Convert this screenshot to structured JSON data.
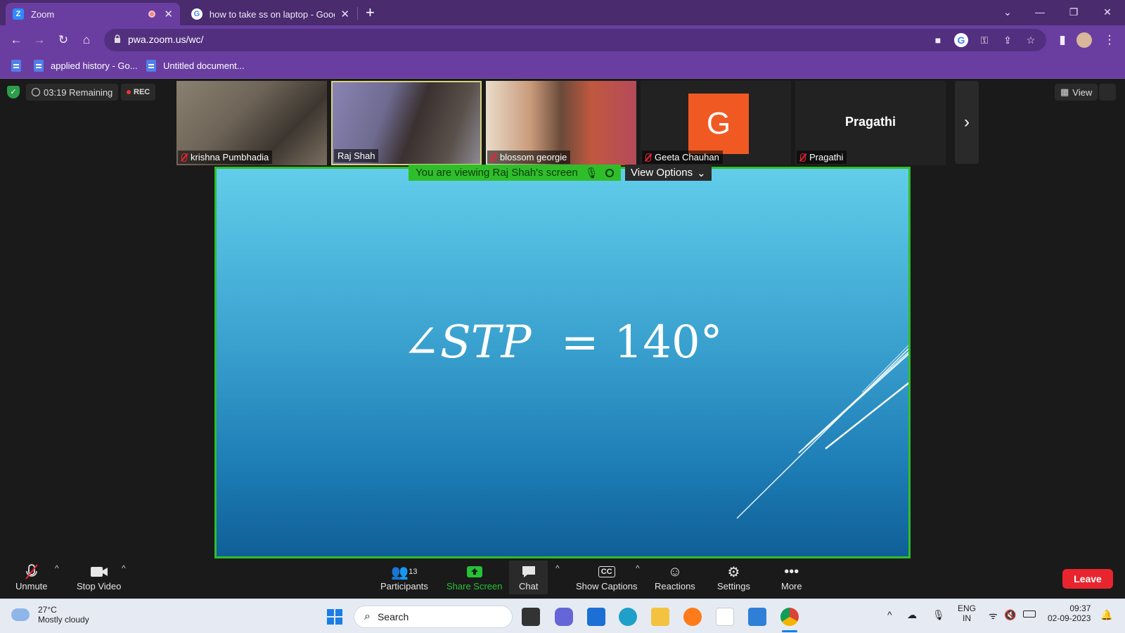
{
  "browser": {
    "tabs": [
      {
        "title": "Zoom",
        "active": true,
        "favicon_letter": "Z"
      },
      {
        "title": "how to take ss on laptop - Googl",
        "active": false
      }
    ],
    "url": "pwa.zoom.us/wc/",
    "bookmarks": [
      "applied history - Go...",
      "Untitled document..."
    ]
  },
  "meeting": {
    "timer": "03:19 Remaining",
    "rec": "REC",
    "view_label": "View",
    "participants": [
      {
        "name": "krishna Pumbhadia",
        "muted": true
      },
      {
        "name": "Raj Shah",
        "muted": false,
        "active_speaker": true
      },
      {
        "name": "blossom georgie",
        "muted": true
      },
      {
        "name": "Geeta Chauhan",
        "muted": true,
        "avatar_letter": "G"
      },
      {
        "name": "Pragathi",
        "muted": true,
        "display_name": "Pragathi"
      }
    ],
    "viewing_banner": "You are viewing Raj Shah's screen",
    "view_options": "View Options",
    "shared_formula": {
      "angle_symbol": "∠",
      "label": "STP",
      "equals": "=",
      "value": "140°"
    }
  },
  "toolbar": {
    "unmute": "Unmute",
    "stop_video": "Stop Video",
    "participants": "Participants",
    "participants_count": "13",
    "share_screen": "Share Screen",
    "chat": "Chat",
    "show_captions": "Show Captions",
    "reactions": "Reactions",
    "settings": "Settings",
    "more": "More",
    "leave": "Leave"
  },
  "taskbar": {
    "temperature": "27°C",
    "weather": "Mostly cloudy",
    "search_placeholder": "Search",
    "lang": "ENG",
    "region": "IN",
    "time": "09:37",
    "date": "02-09-2023"
  },
  "colors": {
    "browser_tabbar": "#4a2b6e",
    "browser_chrome": "#6a3ea0",
    "zoom_bg": "#1a1a1a",
    "share_border": "#2fbe2a",
    "leave_red": "#e8252e",
    "avatar_orange": "#f05a22"
  }
}
